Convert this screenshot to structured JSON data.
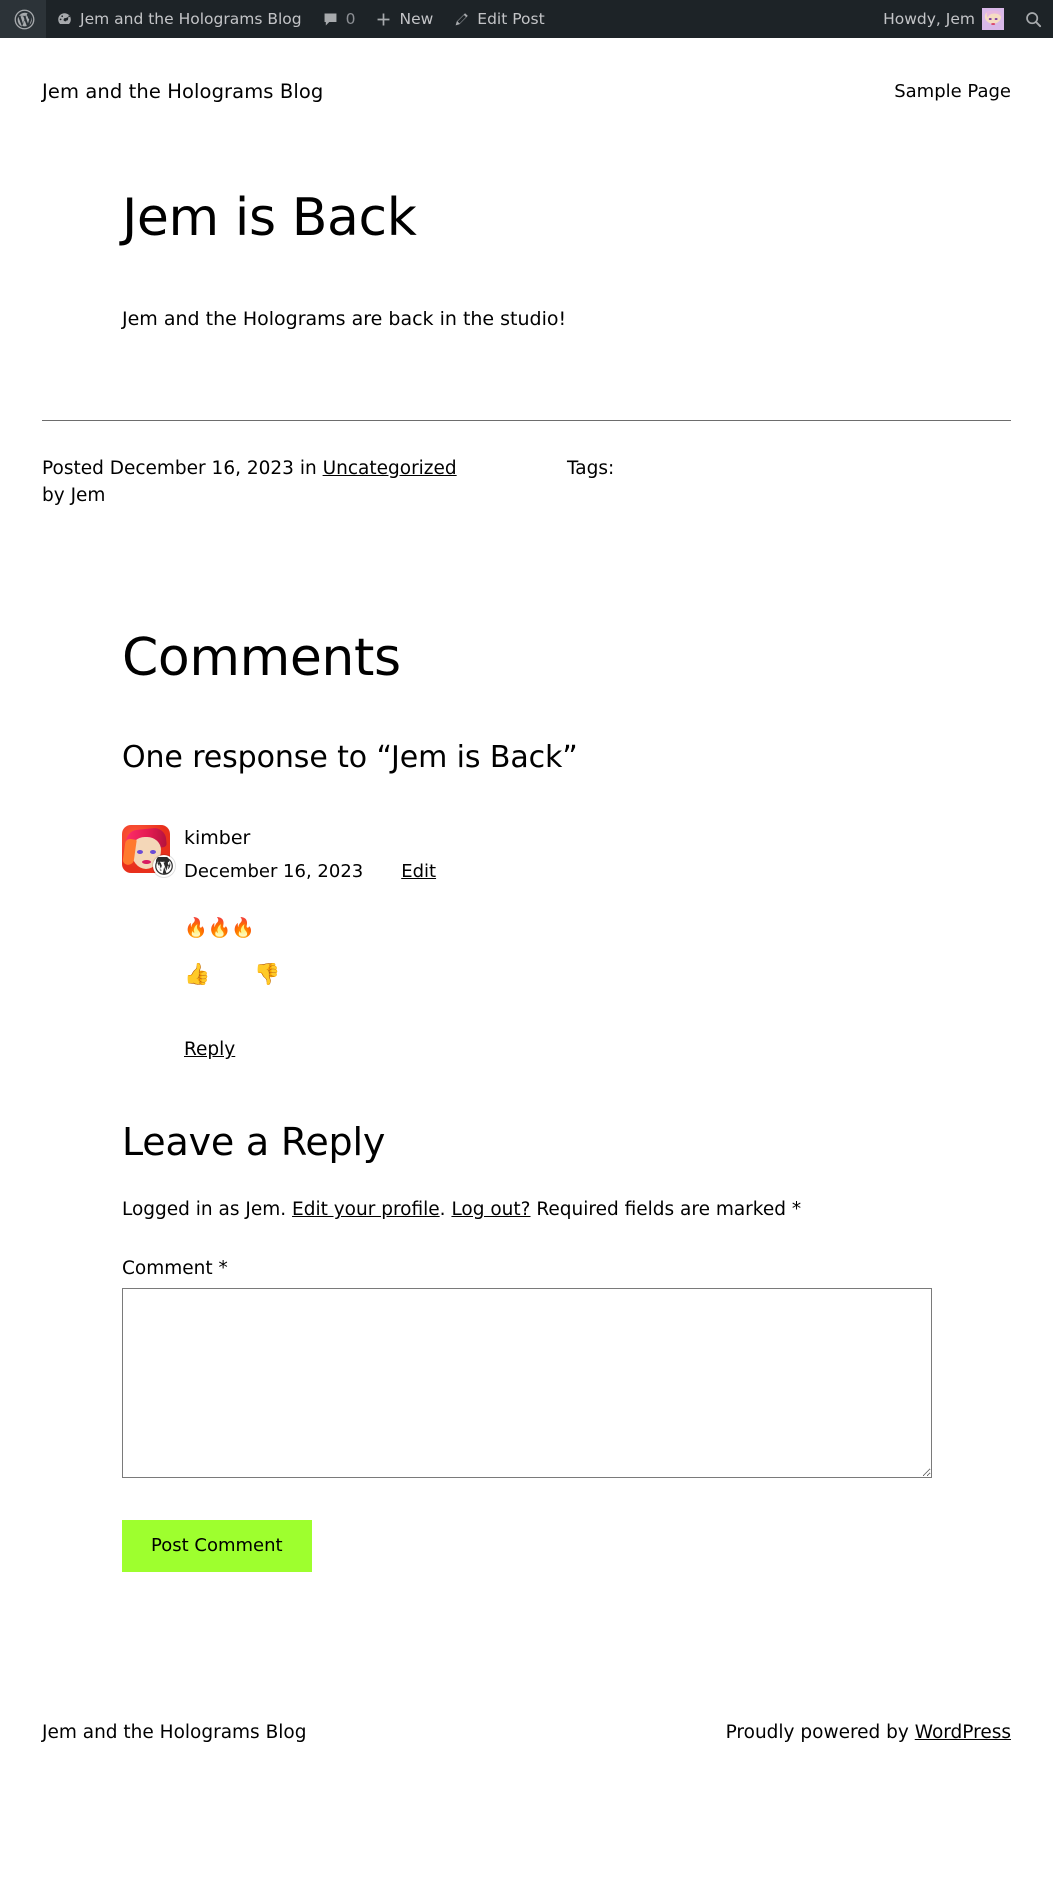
{
  "colors": {
    "adminbar_bg": "#1d2327",
    "adminbar_text": "#c3c4c7",
    "submit_button_bg": "#9eff2e",
    "page_bg": "#ffffff",
    "text": "#000000",
    "rule": "#6d6d6d"
  },
  "adminbar": {
    "wp_logo_label": "About WordPress",
    "site_name": "Jem and the Holograms Blog",
    "comments_count": "0",
    "new_label": "New",
    "edit_post_label": "Edit Post",
    "howdy": "Howdy, Jem",
    "search_label": "Search",
    "icons": {
      "wordpress": "wordpress-logo-icon",
      "dashboard": "dashboard-speedometer-icon",
      "comment": "comment-bubble-icon",
      "plus": "plus-icon",
      "pencil": "pencil-edit-icon",
      "avatar": "user-avatar-icon",
      "search": "search-magnifier-icon"
    }
  },
  "header": {
    "site_title": "Jem and the Holograms Blog",
    "nav": [
      {
        "label": "Sample Page"
      }
    ]
  },
  "post": {
    "title": "Jem is Back",
    "content": "Jem and the Holograms are back in the studio!",
    "meta": {
      "posted_prefix": "Posted",
      "date": "December 16, 2023",
      "in_word": "in",
      "category": "Uncategorized",
      "by_line": "by Jem",
      "tags_label": "Tags:"
    }
  },
  "comments": {
    "heading": "Comments",
    "subheading": "One response to “Jem is Back”",
    "list": [
      {
        "author": "kimber",
        "date": "December 16, 2023",
        "edit_label": "Edit",
        "body": "🔥🔥🔥",
        "thumbs_up": "👍",
        "thumbs_down": "👎",
        "reply_label": "Reply"
      }
    ]
  },
  "reply_form": {
    "title": "Leave a Reply",
    "logged_in_prefix": "Logged in as Jem.",
    "edit_profile_label": "Edit your profile",
    "period_1": ".",
    "logout_label": "Log out?",
    "required_note": "Required fields are marked *",
    "comment_label": "Comment *",
    "comment_value": "",
    "comment_placeholder": "",
    "submit_label": "Post Comment"
  },
  "footer": {
    "site_name": "Jem and the Holograms Blog",
    "credit_prefix": "Proudly powered by",
    "credit_link": "WordPress"
  }
}
